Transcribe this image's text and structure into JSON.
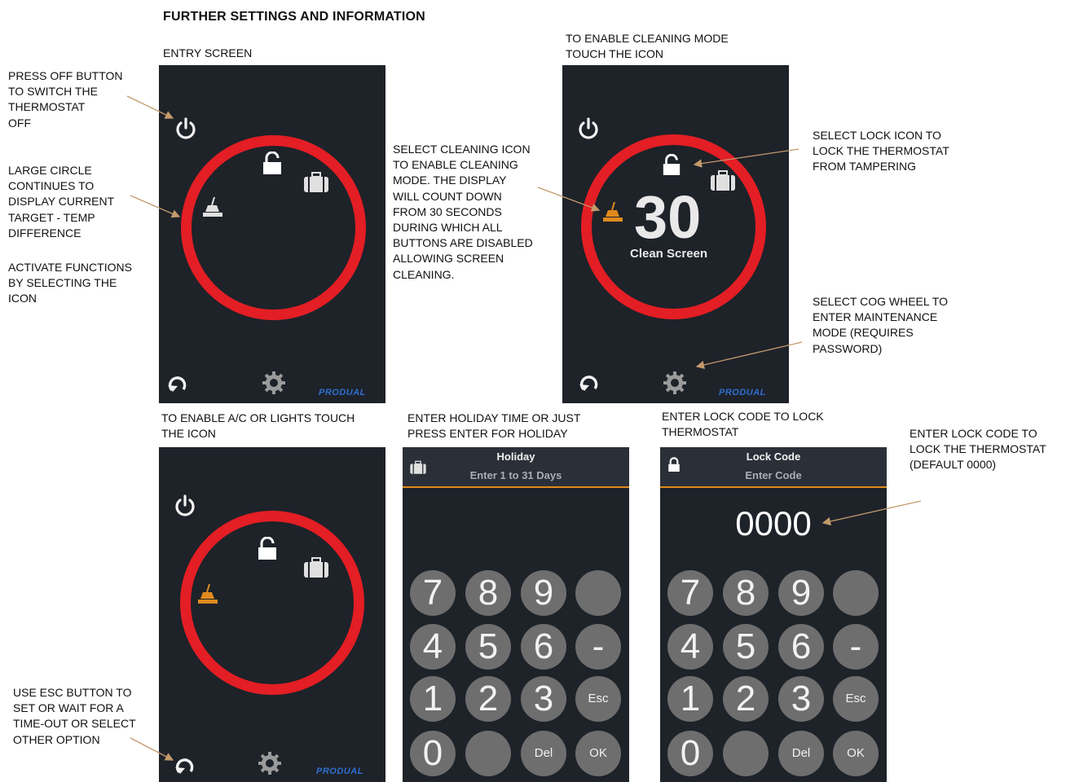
{
  "title": "FURTHER SETTINGS AND INFORMATION",
  "captions": {
    "entry": "ENTRY SCREEN",
    "cleaning": [
      "TO ENABLE CLEANING MODE",
      "TOUCH THE ICON"
    ],
    "ac": [
      "TO ENABLE A/C OR LIGHTS TOUCH",
      "THE ICON"
    ],
    "holiday": [
      "ENTER HOLIDAY TIME OR JUST",
      "PRESS ENTER FOR HOLIDAY"
    ],
    "lock": [
      "ENTER LOCK CODE TO LOCK",
      "THERMOSTAT"
    ]
  },
  "notes": {
    "off": [
      "PRESS OFF BUTTON",
      "TO SWITCH THE",
      "THERMOSTAT",
      "OFF"
    ],
    "circle": [
      "LARGE CIRCLE",
      "CONTINUES TO",
      "DISPLAY CURRENT",
      "TARGET - TEMP",
      "DIFFERENCE"
    ],
    "activate": [
      "ACTIVATE FUNCTIONS",
      "BY SELECTING THE",
      "ICON"
    ],
    "clean": [
      "SELECT CLEANING ICON",
      "TO ENABLE CLEANING",
      "MODE. THE DISPLAY",
      "WILL COUNT DOWN",
      "FROM 30 SECONDS",
      "DURING WHICH ALL",
      "BUTTONS ARE DISABLED",
      "ALLOWING SCREEN",
      "CLEANING."
    ],
    "lockicon": [
      "SELECT LOCK ICON TO",
      "LOCK THE THERMOSTAT",
      "FROM TAMPERING"
    ],
    "cog": [
      "SELECT COG WHEEL TO",
      "ENTER MAINTENANCE",
      "MODE (REQUIRES",
      "PASSWORD)"
    ],
    "esc": [
      "USE ESC BUTTON TO",
      "SET  OR WAIT FOR A",
      "TIME-OUT OR SELECT",
      "OTHER OPTION"
    ],
    "code": [
      "ENTER LOCK CODE TO",
      "LOCK THE THERMOSTAT",
      "(DEFAULT 0000)"
    ]
  },
  "brand": "PRODUAL",
  "countdown": {
    "value": "30",
    "label": "Clean Screen"
  },
  "holiday_pad": {
    "title": "Holiday",
    "subtitle": "Enter 1 to 31 Days"
  },
  "lock_pad": {
    "title": "Lock Code",
    "subtitle": "Enter Code",
    "value": "0000"
  },
  "keypad": [
    [
      "7",
      "8",
      "9",
      ""
    ],
    [
      "4",
      "5",
      "6",
      "-"
    ],
    [
      "1",
      "2",
      "3",
      "Esc"
    ],
    [
      "0",
      "",
      "Del",
      "OK"
    ]
  ],
  "colors": {
    "ring": "#e31e24",
    "active": "#e08a1e",
    "screen": "#1e2229",
    "brand": "#2f6fd0"
  },
  "icons": [
    "power-icon",
    "unlock-icon",
    "briefcase-icon",
    "cleaning-brush-icon",
    "refresh-icon",
    "gear-icon",
    "lock-icon"
  ]
}
